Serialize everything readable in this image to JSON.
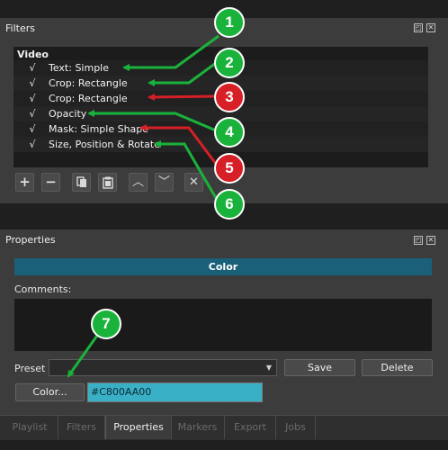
{
  "filters_panel": {
    "title": "Filters",
    "section_header": "Video",
    "items": [
      {
        "check": "√",
        "label": "Text: Simple"
      },
      {
        "check": "√",
        "label": "Crop: Rectangle"
      },
      {
        "check": "√",
        "label": "Crop: Rectangle"
      },
      {
        "check": "√",
        "label": "Opacity"
      },
      {
        "check": "√",
        "label": "Mask: Simple Shape"
      },
      {
        "check": "√",
        "label": "Size, Position & Rotate"
      }
    ],
    "toolbar_icons": [
      "add-icon",
      "remove-icon",
      "copy-icon",
      "paste-icon",
      "move-up-icon",
      "move-down-icon",
      "deselect-icon"
    ]
  },
  "properties_panel": {
    "title": "Properties",
    "filter_name": "Color",
    "comments_label": "Comments:",
    "preset_label": "Preset",
    "preset_value": "",
    "save_label": "Save",
    "delete_label": "Delete",
    "color_button_label": "Color...",
    "color_value": "#C800AA00",
    "color_swatch": "#3ab0c6"
  },
  "tabs": [
    {
      "label": "Playlist",
      "active": false
    },
    {
      "label": "Filters",
      "active": false
    },
    {
      "label": "Properties",
      "active": true
    },
    {
      "label": "Markers",
      "active": false
    },
    {
      "label": "Export",
      "active": false
    },
    {
      "label": "Jobs",
      "active": false
    }
  ],
  "annotations": [
    {
      "number": "1",
      "color": "green"
    },
    {
      "number": "2",
      "color": "green"
    },
    {
      "number": "3",
      "color": "red"
    },
    {
      "number": "4",
      "color": "green"
    },
    {
      "number": "5",
      "color": "red"
    },
    {
      "number": "6",
      "color": "green"
    },
    {
      "number": "7",
      "color": "green"
    }
  ],
  "colors": {
    "annotation_green": "#19b33b",
    "annotation_red": "#d61f26",
    "accent_bar": "#1a6079"
  }
}
